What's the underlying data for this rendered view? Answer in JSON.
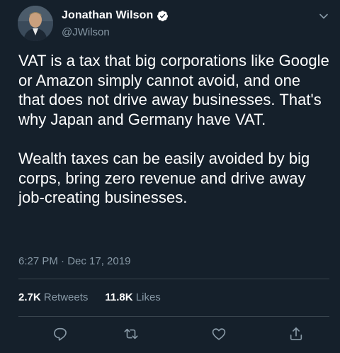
{
  "author": {
    "display_name": "Jonathan Wilson",
    "handle": "@JWilson",
    "verified": true
  },
  "tweet": {
    "text": "VAT is a tax that big corporations like Google or Amazon simply cannot avoid, and one that does not drive away businesses. That's why Japan and Germany have VAT.\n\nWealth taxes can be easily avoided by big corps, bring zero revenue and drive away job-creating businesses.",
    "timestamp": "6:27 PM · Dec 17, 2019"
  },
  "stats": {
    "retweets_count": "2.7K",
    "retweets_label": "Retweets",
    "likes_count": "11.8K",
    "likes_label": "Likes"
  },
  "actions": {
    "reply_icon": "reply-icon",
    "retweet_icon": "retweet-icon",
    "like_icon": "like-icon",
    "share_icon": "share-icon"
  },
  "colors": {
    "background": "#15202b",
    "secondary_text": "#8899a6",
    "divider": "#38444d",
    "verified": "#ffffff"
  }
}
